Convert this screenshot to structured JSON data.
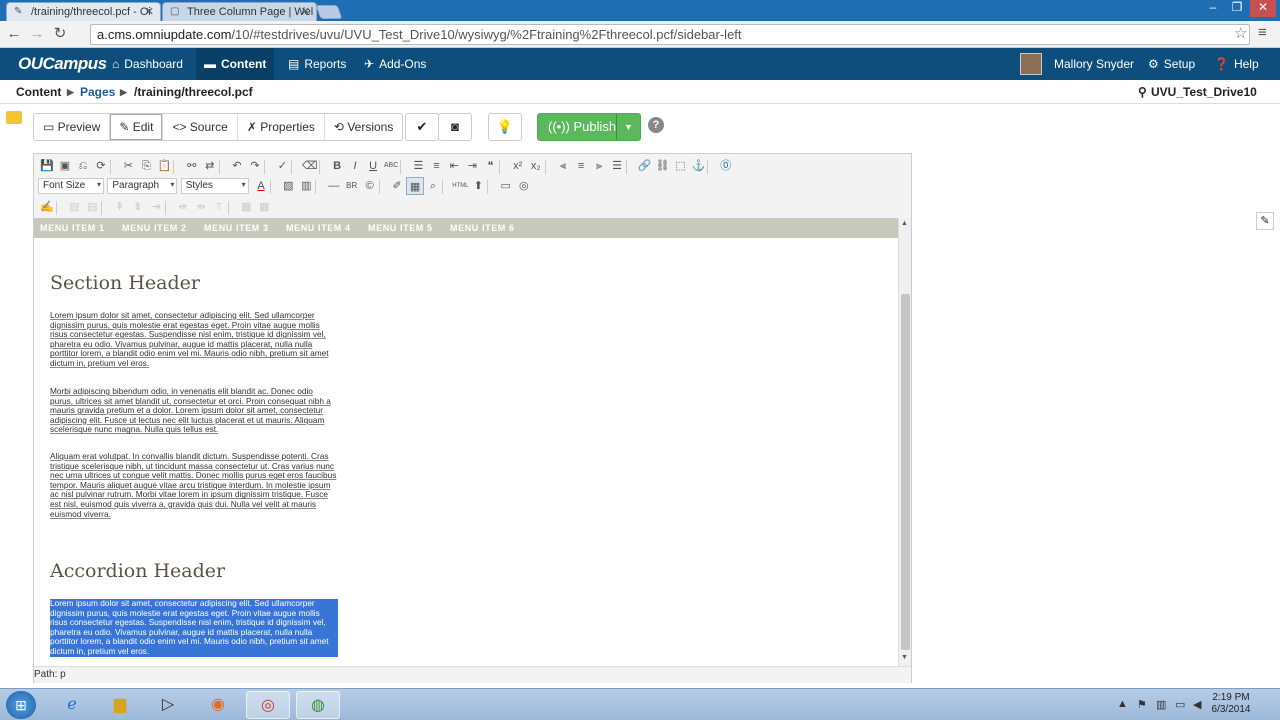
{
  "browser": {
    "tabs": [
      {
        "title": "/training/threecol.pcf - Oi",
        "active": true
      },
      {
        "title": "Three Column Page | Wel",
        "active": false
      }
    ],
    "url_host": "a.cms.omniupdate.com",
    "url_path": "/10/#testdrives/uvu/UVU_Test_Drive10/wysiwyg/%2Ftraining%2Fthreecol.pcf/sidebar-left"
  },
  "app": {
    "logo": "OUCampus",
    "nav": [
      "Dashboard",
      "Content",
      "Reports",
      "Add-Ons"
    ],
    "active_nav": "Content",
    "user": "Mallory Snyder",
    "setup": "Setup",
    "help": "Help"
  },
  "breadcrumb": {
    "root": "Content",
    "section": "Pages",
    "file": "/training/threecol.pcf",
    "site": "UVU_Test_Drive10"
  },
  "toolbar": {
    "modes": [
      "Preview",
      "Edit",
      "Source",
      "Properties",
      "Versions"
    ],
    "active_mode": "Edit",
    "publish_label": "Publish"
  },
  "editor": {
    "font_size_label": "Font Size",
    "paragraph_label": "Paragraph",
    "styles_label": "Styles",
    "menu_items": [
      "MENU ITEM 1",
      "MENU ITEM 2",
      "MENU ITEM 3",
      "MENU ITEM 4",
      "MENU ITEM 5",
      "MENU ITEM 6"
    ],
    "section_header": "Section Header",
    "para1": "Lorem ipsum dolor sit amet, consectetur adipiscing elit. Sed ullamcorper dignissim purus, quis molestie erat egestas eget. Proin vitae augue mollis risus consectetur egestas. Suspendisse nisl enim, tristique id dignissim vel, pharetra eu odio. Vivamus pulvinar, augue id mattis placerat, nulla nulla porttitor lorem, a blandit odio enim vel mi. Mauris odio nibh, pretium sit amet dictum in, pretium vel eros.",
    "para2": "Morbi adipiscing bibendum odio, in venenatis elit blandit ac. Donec odio purus, ultrices sit amet blandit ut, consectetur et orci. Proin consequat nibh a mauris gravida pretium et a dolor. Lorem ipsum dolor sit amet, consectetur adipiscing elit. Fusce ut lectus nec elit luctus placerat et ut mauris. Aliquam scelerisque nunc magna. Nulla quis tellus est.",
    "para3": "Aliquam erat volutpat. In convallis blandit dictum. Suspendisse potenti. Cras tristique scelerisque nibh, ut tincidunt massa consectetur ut. Cras varius nunc nec urna ultrices ut congue velit mattis. Donec mollis purus eget eros faucibus tempor. Mauris aliquet augue vitae arcu tristique interdum. In molestie ipsum ac nisl pulvinar rutrum. Morbi vitae lorem in ipsum dignissim tristique. Fusce est nisl, euismod quis viverra a, gravida quis dui. Nulla vel velit at mauris euismod viverra.",
    "accordion_header": "Accordion Header",
    "para4": "Lorem ipsum dolor sit amet, consectetur adipiscing elit. Sed ullamcorper dignissim purus, quis molestie erat egestas eget. Proin vitae augue mollis risus consectetur egestas. Suspendisse nisl enim, tristique id dignissim vel, pharetra eu odio. Vivamus pulvinar, augue id mattis placerat, nulla nulla porttitor lorem, a blandit odio enim vel mi. Mauris odio nibh, pretium sit amet dictum in, pretium vel eros.",
    "path": "Path: p"
  },
  "taskbar": {
    "time": "2:19 PM",
    "date": "6/3/2014"
  }
}
